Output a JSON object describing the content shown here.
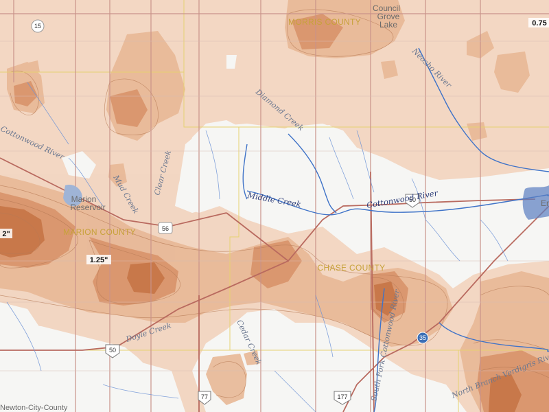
{
  "counties": {
    "morris": "MORRIS COUNTY",
    "marion": "MARION COUNTY",
    "chase": "CHASE COUNTY",
    "harvey": "Newton-City-County"
  },
  "places": {
    "council_grove": [
      "Council",
      "Grove",
      "Lake"
    ],
    "marion_res": [
      "Marion",
      "Reservoir"
    ],
    "emporia": "Em"
  },
  "rivers": {
    "cottonwood_main": "Cottonwood River",
    "cottonwood_west": "Cottonwood River",
    "middle_creek": "Middle Creek",
    "diamond_creek": "Diamond Creek",
    "neosho": "Neosho River",
    "mud_creek": "Mud Creek",
    "clear_creek": "Clear Creek",
    "doyle_creek": "Doyle Creek",
    "cedar_creek": "Cedar Creek",
    "south_fork": "South Fork Cottonwood River",
    "north_branch": "North Branch Verdigris River"
  },
  "routes": [
    "15",
    "56",
    "50",
    "50",
    "77",
    "177",
    "35"
  ],
  "values": {
    "v1": "1.25\"",
    "v2": "2\"",
    "v3": "0.75"
  },
  "colors": {
    "band1": "#f2c9aa",
    "band2": "#e3a47c",
    "band3": "#cf8052",
    "band4": "#b86236",
    "water": "#3f73c8",
    "road": "#c9938a",
    "county_line": "#e6d270"
  }
}
